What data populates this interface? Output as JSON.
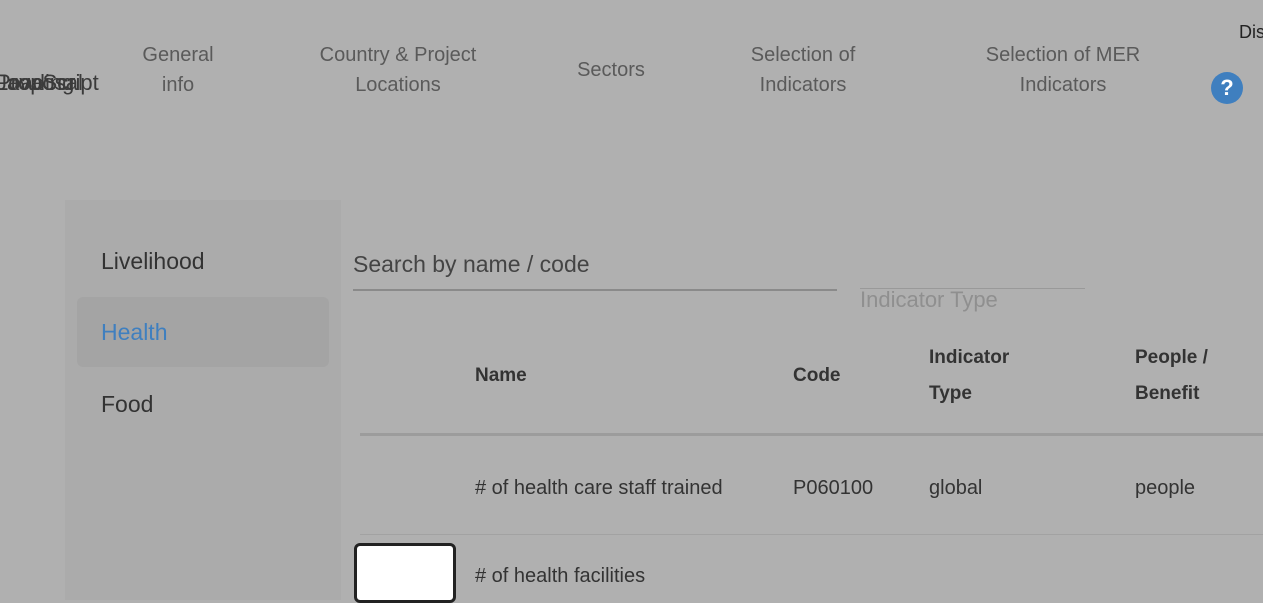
{
  "overlap_text": [
    "JavaScript",
    "Loading",
    "Proposal"
  ],
  "nav": {
    "items": [
      {
        "line1": "General",
        "line2": "info"
      },
      {
        "line1": "Country & Project",
        "line2": "Locations"
      },
      {
        "line1": "Sectors",
        "line2": ""
      },
      {
        "line1": "Selection of",
        "line2": "Indicators"
      },
      {
        "line1": "Selection of MER",
        "line2": "Indicators"
      }
    ],
    "clipped_right": "Dis",
    "help_symbol": "?"
  },
  "sidebar": {
    "items": [
      {
        "label": "Livelihood"
      },
      {
        "label": "Health"
      },
      {
        "label": "Food"
      }
    ],
    "active_index": 1
  },
  "search": {
    "placeholder": "Search by name / code"
  },
  "filter": {
    "indicator_type_label": "Indicator Type"
  },
  "table": {
    "headers": [
      "Name",
      "Code",
      "Indicator Type",
      "People / Benefit"
    ],
    "rows": [
      {
        "name": "# of health care staff trained",
        "code": "P060100",
        "type": "global",
        "benefit": "people"
      },
      {
        "name": "# of health facilities",
        "code": "",
        "type": "",
        "benefit": ""
      }
    ]
  },
  "colors": {
    "accent": "#3f7fbf",
    "overlay": "#b0b0b0"
  }
}
